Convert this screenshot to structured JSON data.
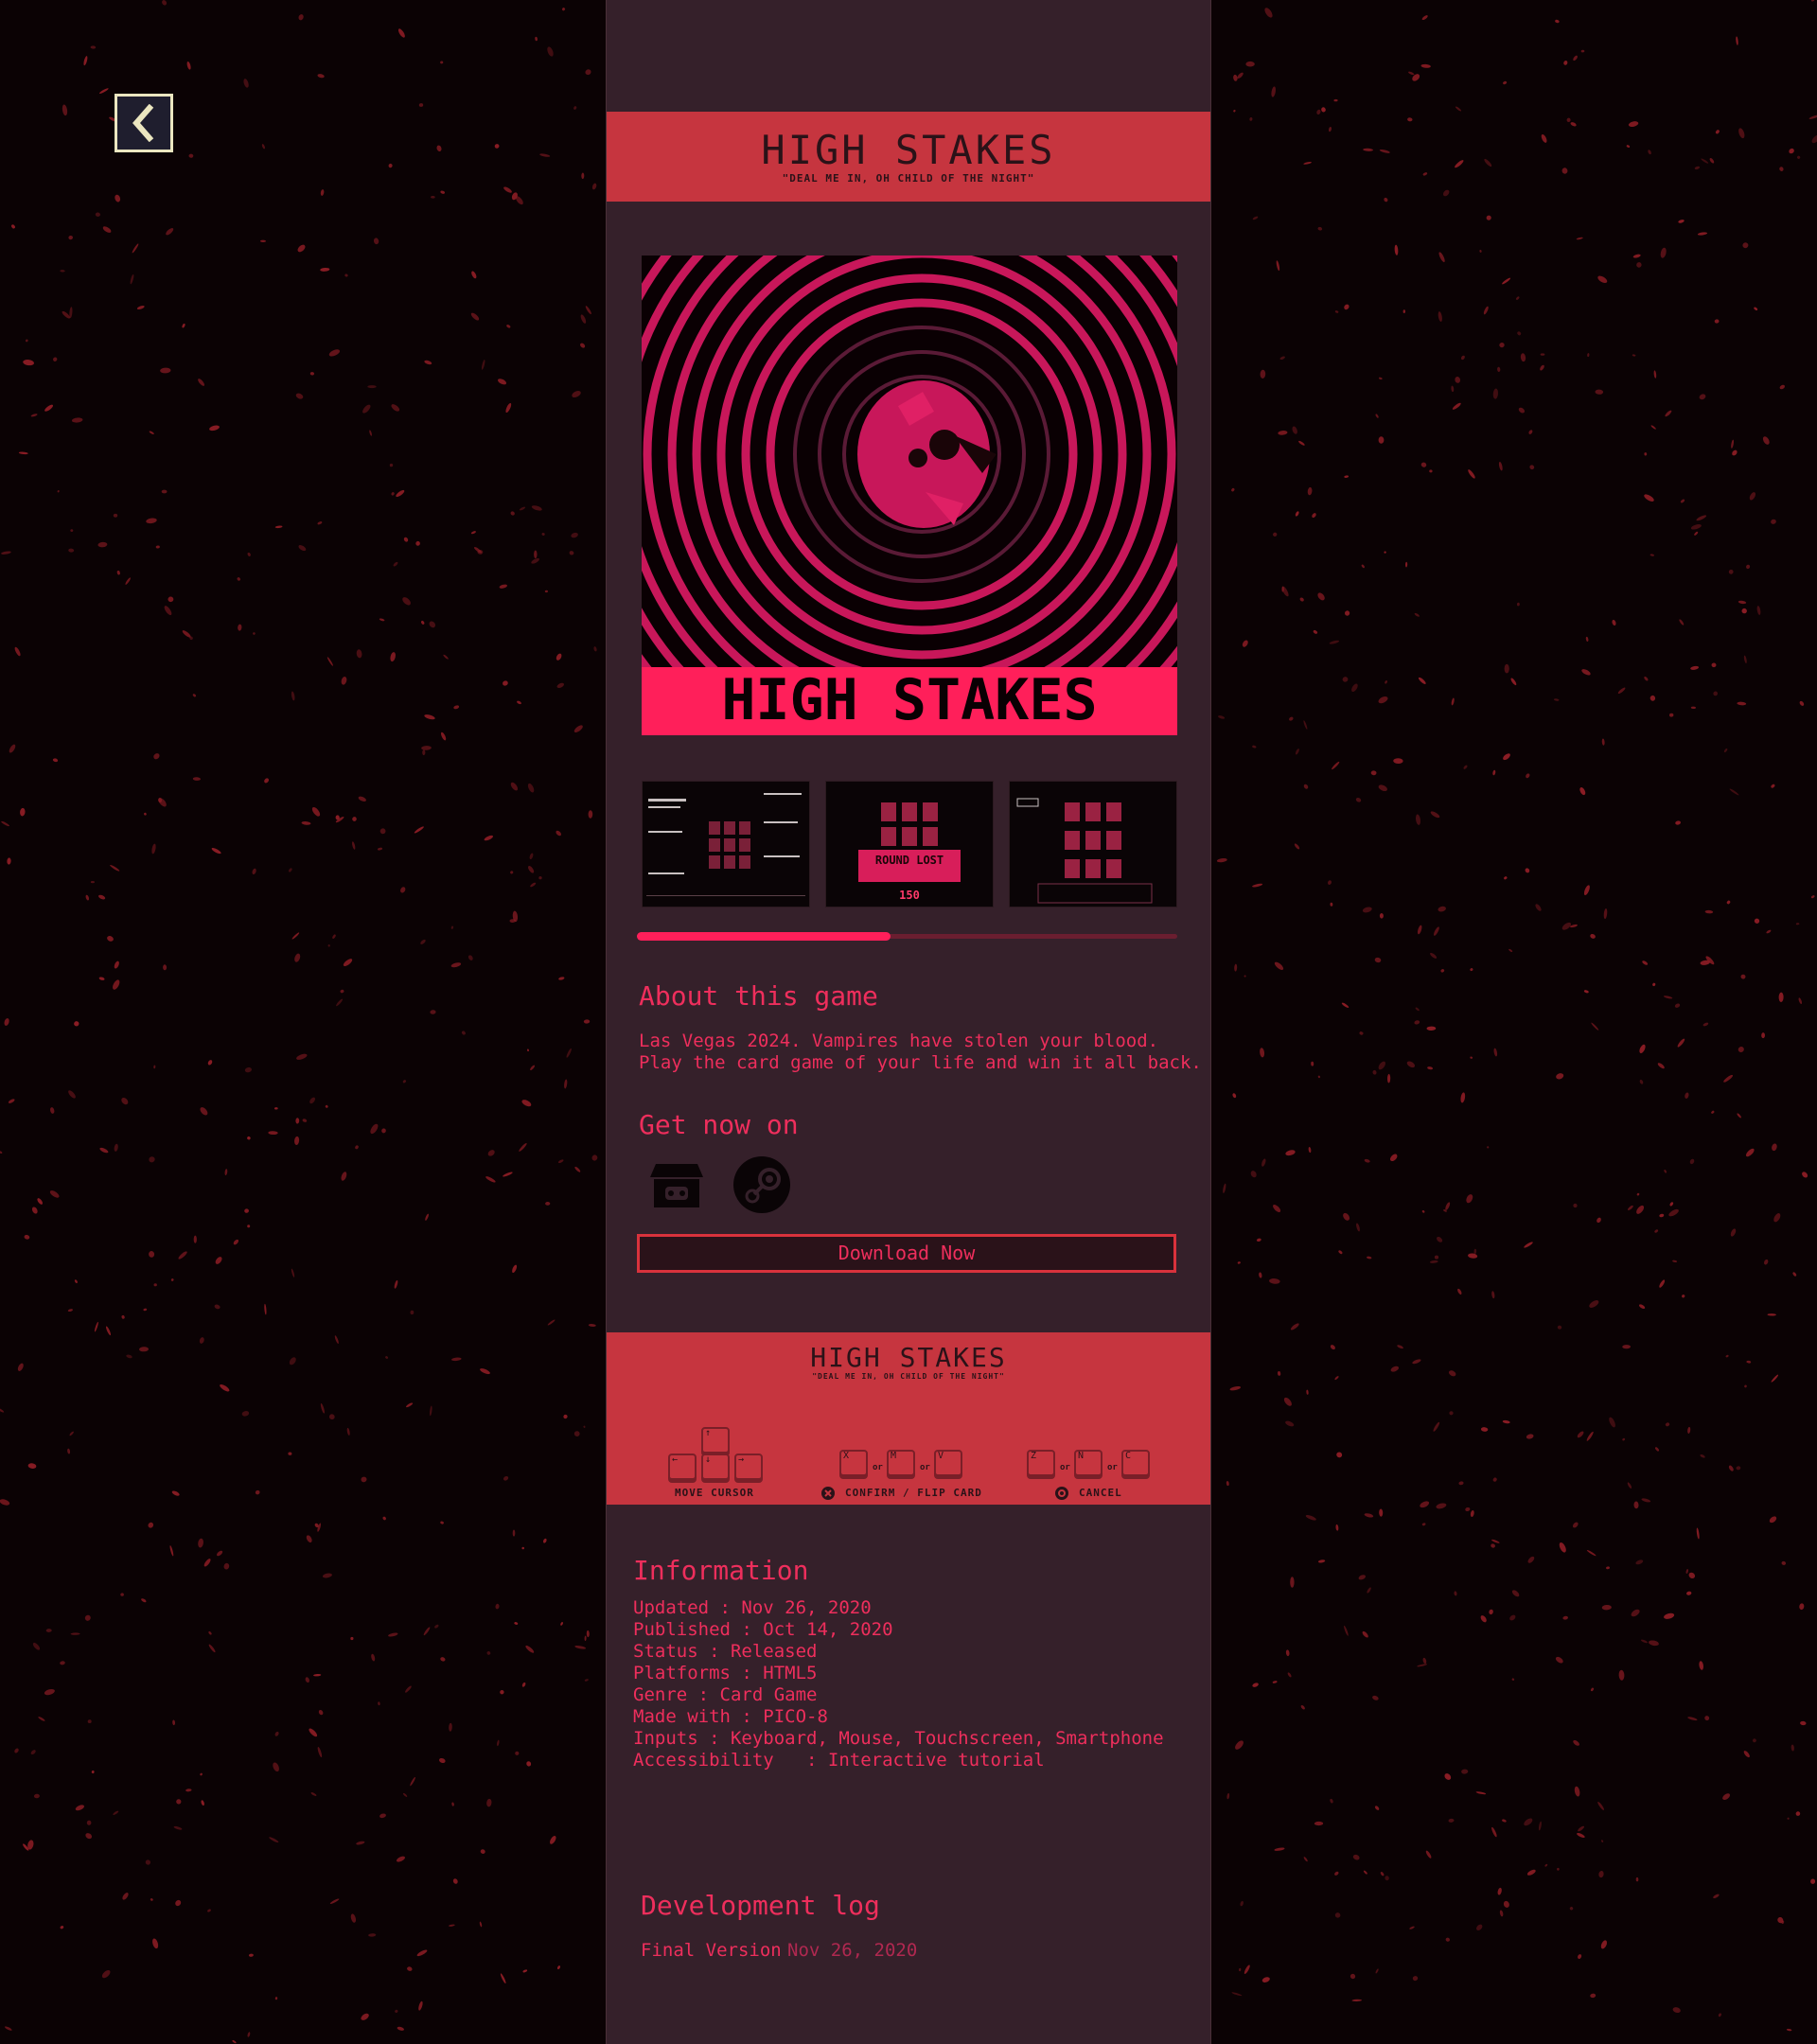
{
  "nav": {
    "back_icon": "chevron-left-icon"
  },
  "header": {
    "title": "HIGH STAKES",
    "tagline": "\"DEAL ME IN, OH CHILD OF THE NIGHT\""
  },
  "cover": {
    "title": "HIGH STAKES",
    "accent": "#ff1f5a"
  },
  "screenshots": [
    {
      "name": "tutorial-screenshot"
    },
    {
      "name": "round-lost-screenshot",
      "caption": "ROUND LOST",
      "score": "150"
    },
    {
      "name": "gameplay-screenshot"
    }
  ],
  "gallery": {
    "scroll_position": 0.47
  },
  "about": {
    "heading": "About this game",
    "line1": "Las Vegas 2024. Vampires have stolen your blood.",
    "line2": "Play the card game of your life and win it all back."
  },
  "get": {
    "heading": "Get now on",
    "stores": [
      {
        "icon": "itch-io-icon"
      },
      {
        "icon": "steam-icon"
      }
    ],
    "download_label": "Download Now"
  },
  "controls": {
    "title": "HIGH STAKES",
    "tagline": "\"DEAL ME IN, OH CHILD OF THE NIGHT\"",
    "move_label": "MOVE CURSOR",
    "confirm_label": "CONFIRM / FLIP CARD",
    "cancel_label": "CANCEL",
    "or": "or",
    "keys": {
      "up": "↑",
      "left": "←",
      "down": "↓",
      "right": "→",
      "x": "X",
      "m": "M",
      "v": "V",
      "z": "Z",
      "n": "N",
      "c": "C"
    }
  },
  "information": {
    "heading": "Information",
    "lines": [
      "Updated : Nov 26, 2020",
      "Published : Oct 14, 2020",
      "Status : Released",
      "Platforms : HTML5",
      "Genre : Card Game",
      "Made with : PICO-8",
      "Inputs : Keyboard, Mouse, Touchscreen, Smartphone",
      "Accessibility   : Interactive tutorial"
    ]
  },
  "devlog": {
    "heading": "Development log",
    "entry_title": "Final Version",
    "entry_date": "Nov 26, 2020"
  },
  "colors": {
    "background": "#0b0204",
    "panel": "#35202a",
    "banner": "#c6353f",
    "text": "#ee2e5c",
    "splatter": "#8a1c24"
  }
}
